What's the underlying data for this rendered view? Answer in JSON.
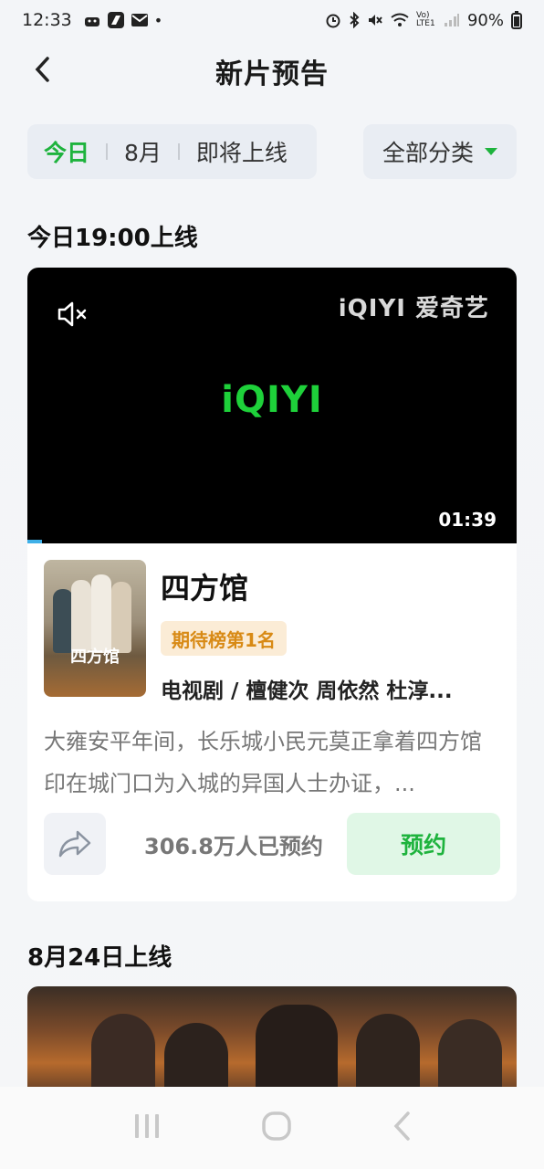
{
  "status_bar": {
    "time": "12:33",
    "dot": "•",
    "battery": "90%",
    "network": "Vo) LTE1"
  },
  "header": {
    "title": "新片预告"
  },
  "filters": {
    "tabs": [
      {
        "label": "今日",
        "active": true
      },
      {
        "label": "8月",
        "active": false
      },
      {
        "label": "即将上线",
        "active": false
      }
    ],
    "category": "全部分类"
  },
  "sections": [
    {
      "date_label": "今日19:00上线",
      "item": {
        "video": {
          "watermark": "iQIYI 爱奇艺",
          "center_logo": "iQIYI",
          "duration": "01:39"
        },
        "poster_title": "四方馆",
        "title": "四方馆",
        "badge": "期待榜第1名",
        "meta": "电视剧 / 檀健次 周依然 杜淳...",
        "description": "大雍安平年间，长乐城小民元莫正拿着四方馆印在城门口为入城的异国人士办证，...",
        "reserve_count": "306.8万人已预约",
        "reserve_label": "预约"
      }
    },
    {
      "date_label": "8月24日上线"
    }
  ],
  "colors": {
    "accent": "#1eb33d",
    "badge_bg": "#fbecd6",
    "badge_text": "#d88a15"
  }
}
